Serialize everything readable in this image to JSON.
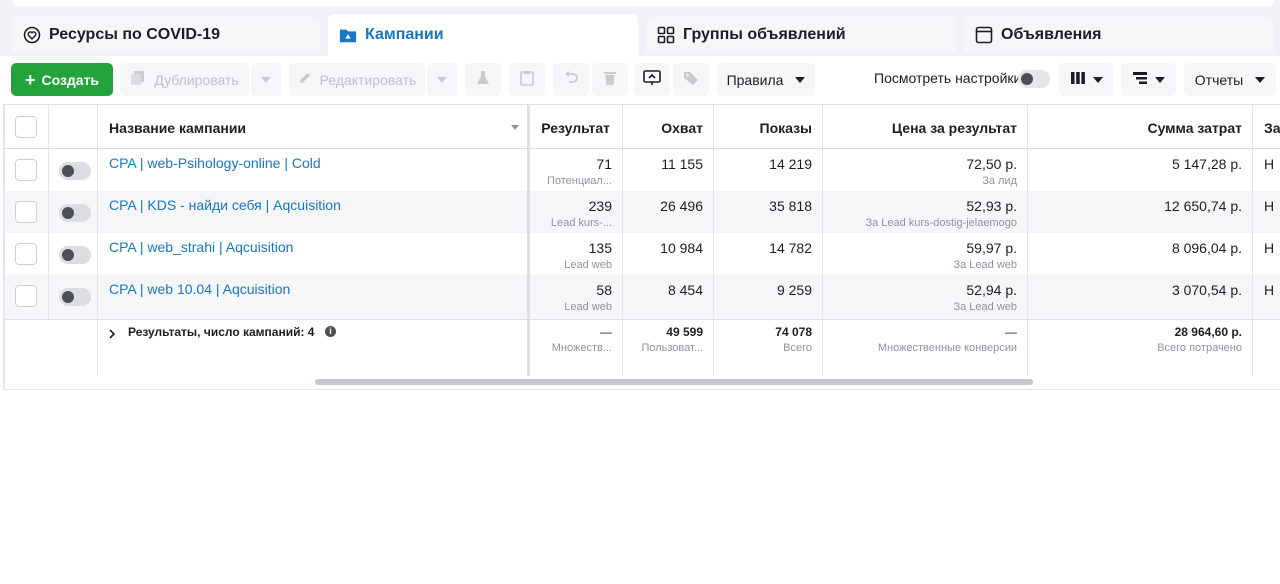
{
  "tabs": [
    {
      "label": "Ресурсы по COVID-19",
      "icon": "heart-circle-icon"
    },
    {
      "label": "Кампании",
      "icon": "folder-icon"
    },
    {
      "label": "Группы объявлений",
      "icon": "grid-icon"
    },
    {
      "label": "Объявления",
      "icon": "ad-window-icon"
    }
  ],
  "toolbar": {
    "create": "Создать",
    "duplicate": "Дублировать",
    "edit": "Редактировать",
    "rules": "Правила",
    "view_settings": "Посмотреть настройки",
    "reports": "Отчеты"
  },
  "table": {
    "headers": {
      "name": "Название кампании",
      "result": "Результат",
      "reach": "Охват",
      "impressions": "Показы",
      "cost_per_result": "Цена за результат",
      "amount_spent": "Сумма затрат",
      "extra": "За"
    },
    "rows": [
      {
        "name": "CPA | web-Psihology-online | Cold",
        "result": "71",
        "result_sub": "Потенциал...",
        "reach": "11 155",
        "impressions": "14 219",
        "cost": "72,50 р.",
        "cost_sub": "За лид",
        "spent": "5 147,28 р.",
        "extra": "Н"
      },
      {
        "name": "CPA | KDS - найди себя | Aqcuisition",
        "result": "239",
        "result_sub": "Lead kurs-...",
        "reach": "26 496",
        "impressions": "35 818",
        "cost": "52,93 р.",
        "cost_sub": "За Lead kurs-dostig-jelaemogo",
        "spent": "12 650,74 р.",
        "extra": "Н"
      },
      {
        "name": "CPA | web_strahi | Aqcuisition",
        "result": "135",
        "result_sub": "Lead web",
        "reach": "10 984",
        "impressions": "14 782",
        "cost": "59,97 р.",
        "cost_sub": "За Lead web",
        "spent": "8 096,04 р.",
        "extra": "Н"
      },
      {
        "name": "CPA | web 10.04 | Aqcuisition",
        "result": "58",
        "result_sub": "Lead web",
        "reach": "8 454",
        "impressions": "9 259",
        "cost": "52,94 р.",
        "cost_sub": "За Lead web",
        "spent": "3 070,54 р.",
        "extra": "Н"
      }
    ],
    "summary": {
      "label": "Результаты, число кампаний: 4",
      "result": "—",
      "result_sub": "Множеств...",
      "reach": "49 599",
      "reach_sub": "Пользоват...",
      "impressions": "74 078",
      "impressions_sub": "Всего",
      "cost": "—",
      "cost_sub": "Множественные конверсии",
      "spent": "28 964,60 р.",
      "spent_sub": "Всего потрачено"
    }
  },
  "colors": {
    "accent_blue": "#1876c2",
    "create_green": "#24a33a"
  }
}
